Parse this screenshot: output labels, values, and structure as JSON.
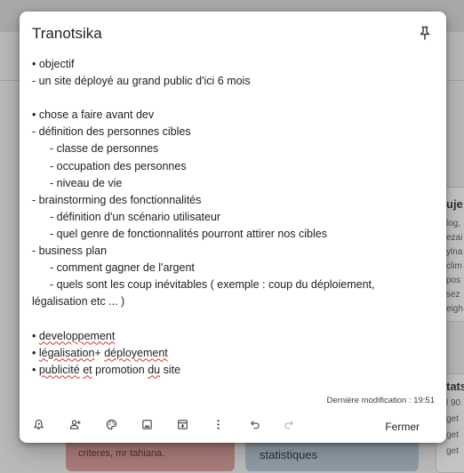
{
  "background": {
    "right_card_title": "uje",
    "right_card_lines": [
      "log,",
      "ezai",
      "ylna",
      "clim",
      "pos",
      "sez",
      "eigh"
    ],
    "right_card2_title": "tats",
    "right_card2_lines": [
      "l 90",
      "get",
      "get",
      "get"
    ],
    "bottom_left_card_text": "criteres, mr tahiana.",
    "bottom_right_card_title": "statistiques"
  },
  "note": {
    "title": "Tranotsika",
    "modified": "Dernière modification : 19:51",
    "close_label": "Fermer",
    "lines": {
      "l1": "• objectif",
      "l2": "- un site déployé au grand public d'ici 6 mois",
      "l4": "• chose a faire avant dev",
      "l5": "- définition des personnes cibles",
      "l6": "- classe de personnes",
      "l7": "- occupation des personnes",
      "l8": "- niveau de vie",
      "l9": "- brainstorming des fonctionnalités",
      "l10": "- définition d'un scénario utilisateur",
      "l11": "- quel genre de fonctionnalités pourront attirer nos cibles",
      "l12": "- business plan",
      "l13": "- comment gagner de l'argent",
      "l14": "- quels sont les coup inévitables ( exemple : coup du déploiement, légalisation etc ... )",
      "l16_bullet": "• ",
      "l16_word": "developpement",
      "l17_bullet": "• ",
      "l17_w1": "légalisation",
      "l17_mid": "+ ",
      "l17_w2": "déployement",
      "l18_bullet": "• ",
      "l18_w1": "publicité",
      "l18_sp1": " ",
      "l18_w2": "et",
      "l18_mid": " promotion ",
      "l18_w3": "du",
      "l18_end": " site"
    }
  },
  "toolbar": {
    "icons": [
      "remind-icon",
      "collaborator-icon",
      "palette-icon",
      "image-icon",
      "archive-icon",
      "more-icon",
      "undo-icon",
      "redo-icon"
    ]
  },
  "colors": {
    "spellcheck": "#d93025",
    "text": "#202124",
    "overlay": "#b9b9b9"
  }
}
